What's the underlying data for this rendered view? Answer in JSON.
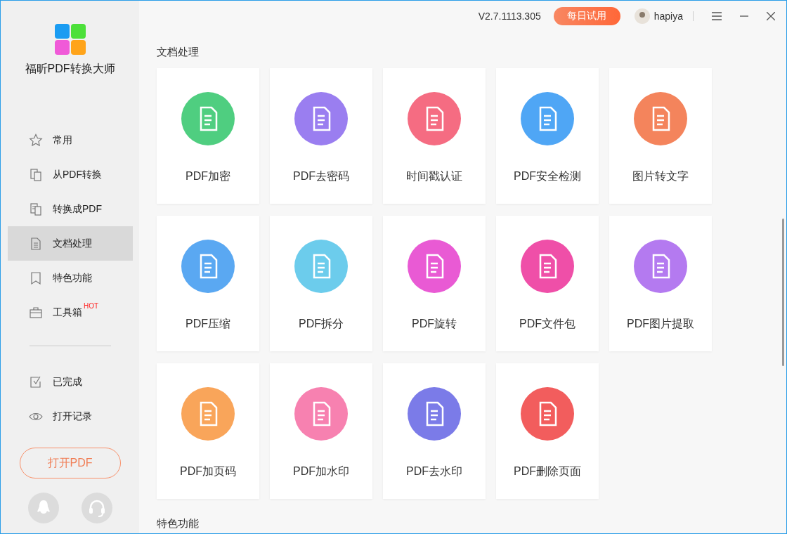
{
  "app": {
    "name": "福昕PDF转换大师"
  },
  "sidebar": {
    "items": [
      {
        "label": "常用",
        "kind": "star",
        "selected": false
      },
      {
        "label": "从PDF转换",
        "kind": "from",
        "selected": false
      },
      {
        "label": "转换成PDF",
        "kind": "to",
        "selected": false
      },
      {
        "label": "文档处理",
        "kind": "doc",
        "selected": true
      },
      {
        "label": "特色功能",
        "kind": "bookmark",
        "selected": false
      },
      {
        "label": "工具箱",
        "kind": "toolbox",
        "badge": "HOT",
        "selected": false
      }
    ],
    "secondary": [
      {
        "label": "已完成",
        "kind": "check"
      },
      {
        "label": "打开记录",
        "kind": "eye"
      }
    ],
    "open_button": "打开PDF"
  },
  "topbar": {
    "version": "V2.7.1113.305",
    "trial_button": "每日试用",
    "user": "hapiya"
  },
  "section_title": "文档处理",
  "tools": [
    {
      "label": "PDF加密",
      "color": "#4fce80"
    },
    {
      "label": "PDF去密码",
      "color": "#9a7ef0"
    },
    {
      "label": "时间戳认证",
      "color": "#f56c82"
    },
    {
      "label": "PDF安全检测",
      "color": "#4fa6f5"
    },
    {
      "label": "图片转文字",
      "color": "#f4845c"
    },
    {
      "label": "PDF压缩",
      "color": "#5aa8f2"
    },
    {
      "label": "PDF拆分",
      "color": "#6cccec"
    },
    {
      "label": "PDF旋转",
      "color": "#e95ad4"
    },
    {
      "label": "PDF文件包",
      "color": "#ef4fa8"
    },
    {
      "label": "PDF图片提取",
      "color": "#b47af0"
    },
    {
      "label": "PDF加页码",
      "color": "#f9a55a"
    },
    {
      "label": "PDF加水印",
      "color": "#f781b0"
    },
    {
      "label": "PDF去水印",
      "color": "#7b7be8"
    },
    {
      "label": "PDF删除页面",
      "color": "#f25d5d"
    }
  ],
  "next_section_title": "特色功能"
}
